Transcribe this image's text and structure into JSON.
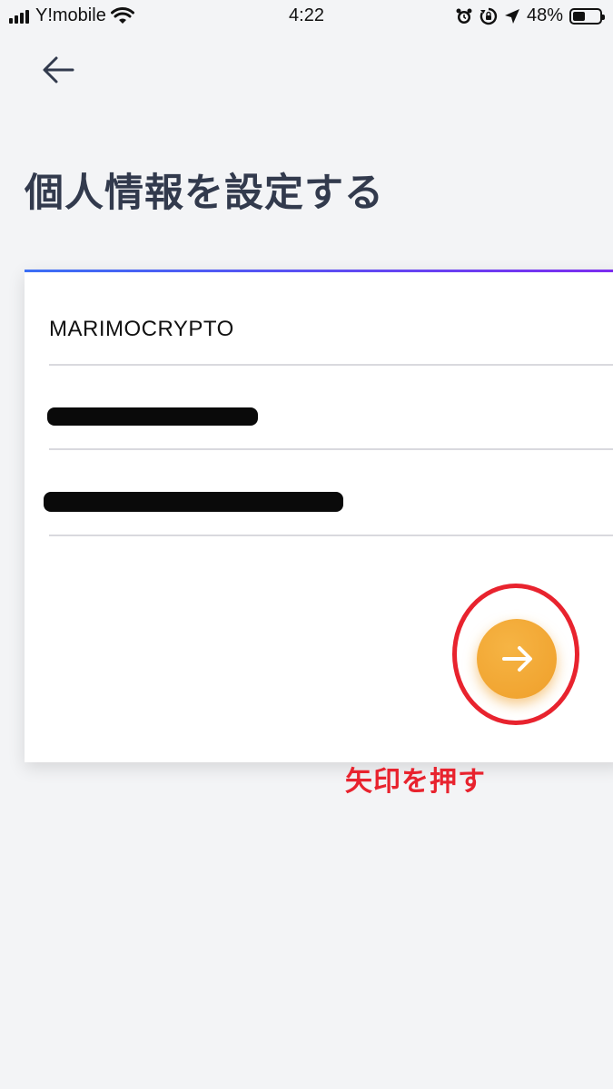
{
  "status_bar": {
    "carrier": "Y!mobile",
    "time": "4:22",
    "battery_percent": "48%",
    "battery_level": 0.48,
    "icons": [
      "signal-icon",
      "wifi-icon",
      "alarm-icon",
      "rotation-lock-icon",
      "location-icon",
      "battery-icon"
    ]
  },
  "header": {
    "back_icon": "arrow-left-icon",
    "title": "個人情報を設定する"
  },
  "form": {
    "accent_gradient": [
      "#3b6ff5",
      "#7d2bf0"
    ],
    "fields": [
      {
        "value": "MARIMOCRYPTO",
        "redacted": false
      },
      {
        "value": "",
        "redacted": true
      },
      {
        "value": "",
        "redacted": true
      }
    ],
    "next_icon": "arrow-right-icon",
    "next_button_color": "#f0a432"
  },
  "annotation": {
    "label": "矢印を押す",
    "color": "#e8232e"
  }
}
